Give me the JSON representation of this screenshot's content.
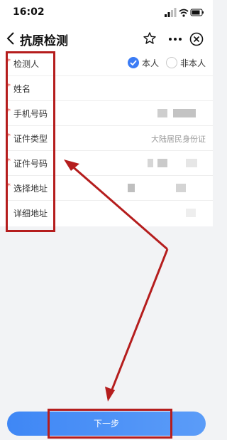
{
  "status_bar": {
    "time": "16:02"
  },
  "nav": {
    "title": "抗原检测"
  },
  "form": {
    "rows": [
      {
        "required_mark": "*",
        "label": "检测人"
      },
      {
        "required_mark": "*",
        "label": "姓名"
      },
      {
        "required_mark": "*",
        "label": "手机号码"
      },
      {
        "required_mark": "*",
        "label": "证件类型",
        "value": "大陆居民身份证"
      },
      {
        "required_mark": "*",
        "label": "证件号码"
      },
      {
        "required_mark": "*",
        "label": "选择地址"
      },
      {
        "required_mark": "",
        "label": "详细地址"
      }
    ],
    "radio": {
      "self": "本人",
      "other": "非本人",
      "selected": "self"
    }
  },
  "submit": {
    "label": "下一步"
  },
  "colors": {
    "accent": "#3b7cf5",
    "highlight": "#b51d1d",
    "required": "#e5483d"
  },
  "icons": [
    "back-icon",
    "star-icon",
    "more-icon",
    "close-icon",
    "signal-icon",
    "wifi-icon",
    "battery-icon"
  ]
}
